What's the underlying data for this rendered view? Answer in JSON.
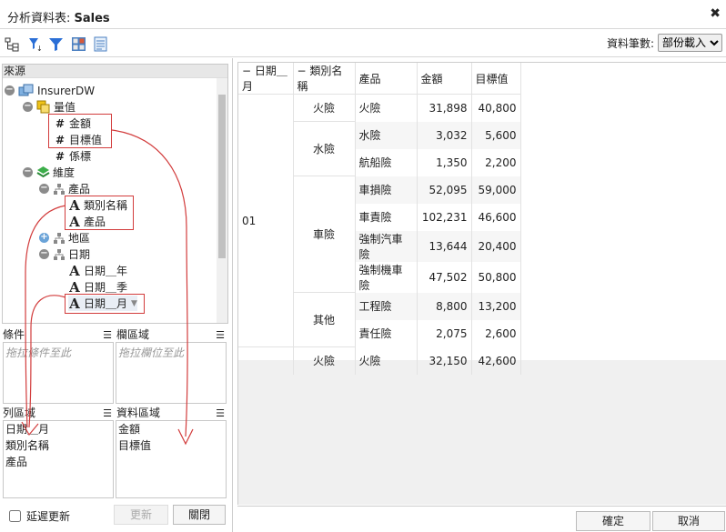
{
  "window": {
    "title_prefix": "分析資料表: ",
    "title_name": "Sales"
  },
  "toolbar": {
    "rowcount_label": "資料筆數:",
    "rowcount_value": "部份載入"
  },
  "source": {
    "label": "來源",
    "nodes": {
      "root": "InsurerDW",
      "measures": "量值",
      "amount": "金額",
      "target": "目標值",
      "index": "係標",
      "dimensions": "維度",
      "product_dim": "產品",
      "category_name": "類別名稱",
      "product": "產品",
      "region": "地區",
      "date_dim": "日期",
      "date_year": "日期＿年",
      "date_season": "日期＿季",
      "date_month": "日期＿月"
    }
  },
  "zones": {
    "filter": {
      "title": "條件",
      "placeholder": "拖拉條件至此"
    },
    "column": {
      "title": "欄區域",
      "placeholder": "拖拉欄位至此"
    },
    "row": {
      "title": "列區域",
      "items": [
        "日期＿月",
        "類別名稱",
        "產品"
      ]
    },
    "data": {
      "title": "資料區域",
      "items": [
        "金額",
        "目標值"
      ]
    }
  },
  "bottom": {
    "defer_label": "延遲更新",
    "update_label": "更新",
    "close_label": "關閉"
  },
  "pivot": {
    "headers": [
      "− 日期＿月",
      "− 類別名稱",
      "產品",
      "金額",
      "目標值"
    ],
    "month": "01",
    "rows": [
      {
        "category": "火險",
        "product": "火險",
        "amount": "31,898",
        "target": "40,800"
      },
      {
        "category": "水險",
        "product": "水險",
        "amount": "3,032",
        "target": "5,600"
      },
      {
        "category": "",
        "product": "航船險",
        "amount": "1,350",
        "target": "2,200"
      },
      {
        "category": "車險",
        "product": "車損險",
        "amount": "52,095",
        "target": "59,000"
      },
      {
        "category": "",
        "product": "車責險",
        "amount": "102,231",
        "target": "46,600"
      },
      {
        "category": "",
        "product": "強制汽車險",
        "amount": "13,644",
        "target": "20,400"
      },
      {
        "category": "",
        "product": "強制機車險",
        "amount": "47,502",
        "target": "50,800"
      },
      {
        "category": "其他",
        "product": "工程險",
        "amount": "8,800",
        "target": "13,200"
      },
      {
        "category": "",
        "product": "責任險",
        "amount": "2,075",
        "target": "2,600"
      },
      {
        "category": "火險",
        "product": "火險",
        "amount": "32,150",
        "target": "42,600"
      }
    ]
  },
  "footer": {
    "ok_label": "確定",
    "cancel_label": "取消"
  },
  "colors": {
    "annotation": "#d23c3c",
    "filter_icon": "#2b6fd6"
  }
}
